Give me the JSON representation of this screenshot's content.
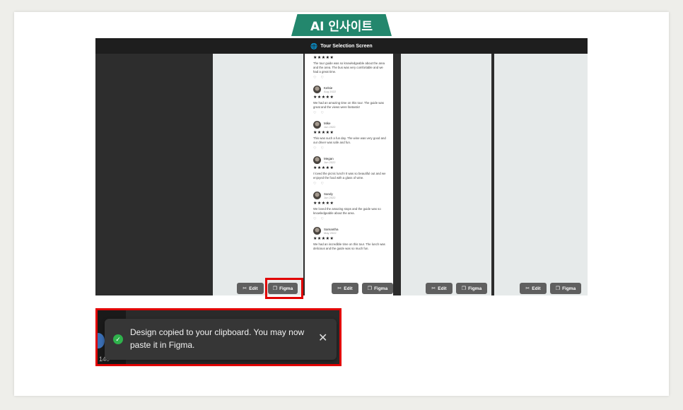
{
  "header": {
    "title": "AI 인사이트"
  },
  "screen": {
    "title": "Tour Selection Screen"
  },
  "reviews": [
    {
      "name": "",
      "date": "",
      "stars": "★★★★★",
      "text": "The tour guide was so knowledgeable about the area and the area. The bus was very comfortable and we had a great time."
    },
    {
      "name": "Kelsie",
      "date": "Aug 2022",
      "stars": "★★★★★",
      "text": "We had an amazing time on this tour. The guide was great and the views were fantastic!"
    },
    {
      "name": "Mike",
      "date": "Jun 2022",
      "stars": "★★★★★",
      "text": "This was such a fun day. The wine was very good and our driver was safe and fun."
    },
    {
      "name": "Megan",
      "date": "Jun 2022",
      "stars": "★★★★★",
      "text": "I loved the picnic lunch! It was so beautiful out and we enjoyed the food with a glass of wine."
    },
    {
      "name": "Sandy",
      "date": "Jun 2022",
      "stars": "★★★★★",
      "text": "We loved the amazing stops and the guide was so knowledgeable about the area."
    },
    {
      "name": "Samantha",
      "date": "May 2022",
      "stars": "★★★★★",
      "text": "We had an incredible time on this tour. The lunch was delicious and the guide was so much fun."
    }
  ],
  "buttons": {
    "edit": "Edit",
    "figma": "Figma"
  },
  "toast": {
    "message": "Design copied to your clipboard. You may now paste it in Figma.",
    "close": "✕",
    "bg_count": "140"
  },
  "icons": {
    "globe": "🌐",
    "edit": "✂",
    "figma": "❐",
    "like": "♡",
    "reply": "💬",
    "check": "✓"
  },
  "colors": {
    "accent": "#23876d",
    "highlight": "#e10000",
    "success": "#2fb24c"
  }
}
